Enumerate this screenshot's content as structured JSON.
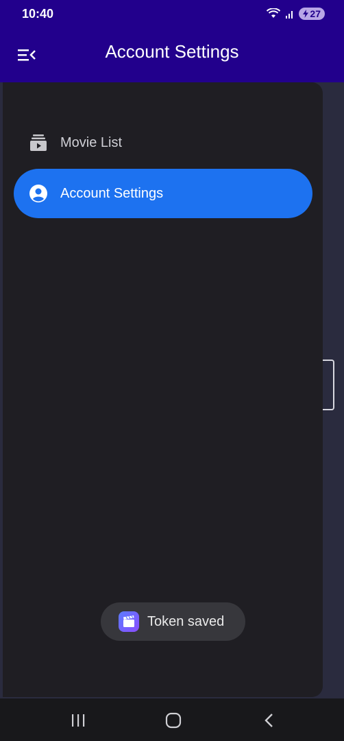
{
  "status_bar": {
    "time": "10:40",
    "battery": "27",
    "icons": [
      "wifi-icon",
      "signal-icon",
      "battery-charging-icon"
    ]
  },
  "app_bar": {
    "title": "Account Settings",
    "menu_icon": "menu-open-icon"
  },
  "drawer": {
    "items": [
      {
        "label": "Movie List",
        "icon": "movie-list-icon",
        "active": false
      },
      {
        "label": "Account Settings",
        "icon": "account-circle-icon",
        "active": true
      }
    ]
  },
  "toast": {
    "text": "Token saved",
    "icon": "app-clapperboard-icon"
  },
  "system_nav": {
    "buttons": [
      "recents-icon",
      "home-icon",
      "back-icon"
    ]
  },
  "colors": {
    "app_bar": "#22008c",
    "drawer": "#1f1e23",
    "active_item": "#1d72f0",
    "content": "#2a2b3e"
  }
}
